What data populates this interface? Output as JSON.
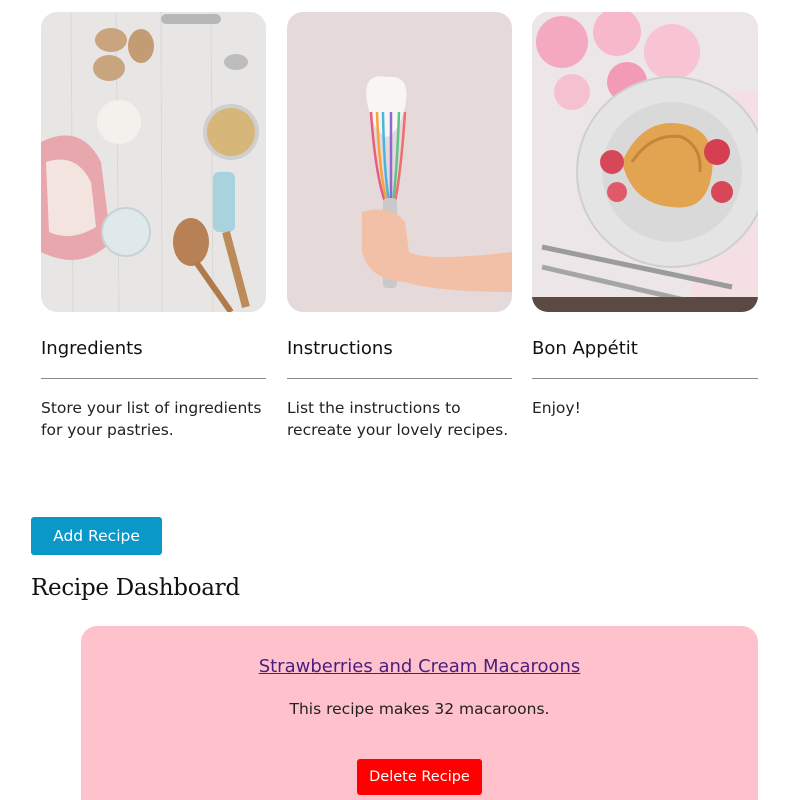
{
  "cards": [
    {
      "title": "Ingredients",
      "description": "Store your list of ingredients for your pastries.",
      "image_icon": "baking-ingredients-photo"
    },
    {
      "title": "Instructions",
      "description": "List the instructions to recreate your lovely recipes.",
      "image_icon": "whisk-photo"
    },
    {
      "title": "Bon Appétit",
      "description": "Enjoy!",
      "image_icon": "croissant-plate-photo"
    }
  ],
  "actions": {
    "add_recipe_label": "Add Recipe"
  },
  "dashboard": {
    "title": "Recipe Dashboard",
    "recipes": [
      {
        "name": "Strawberries and Cream Macaroons",
        "description": "This recipe makes 32 macaroons.",
        "delete_label": "Delete Recipe"
      }
    ]
  },
  "colors": {
    "primary_button": "#0a98c9",
    "delete_button": "#ff0000",
    "recipe_card_bg": "#ffc2cd",
    "link": "#4b1e7e"
  }
}
